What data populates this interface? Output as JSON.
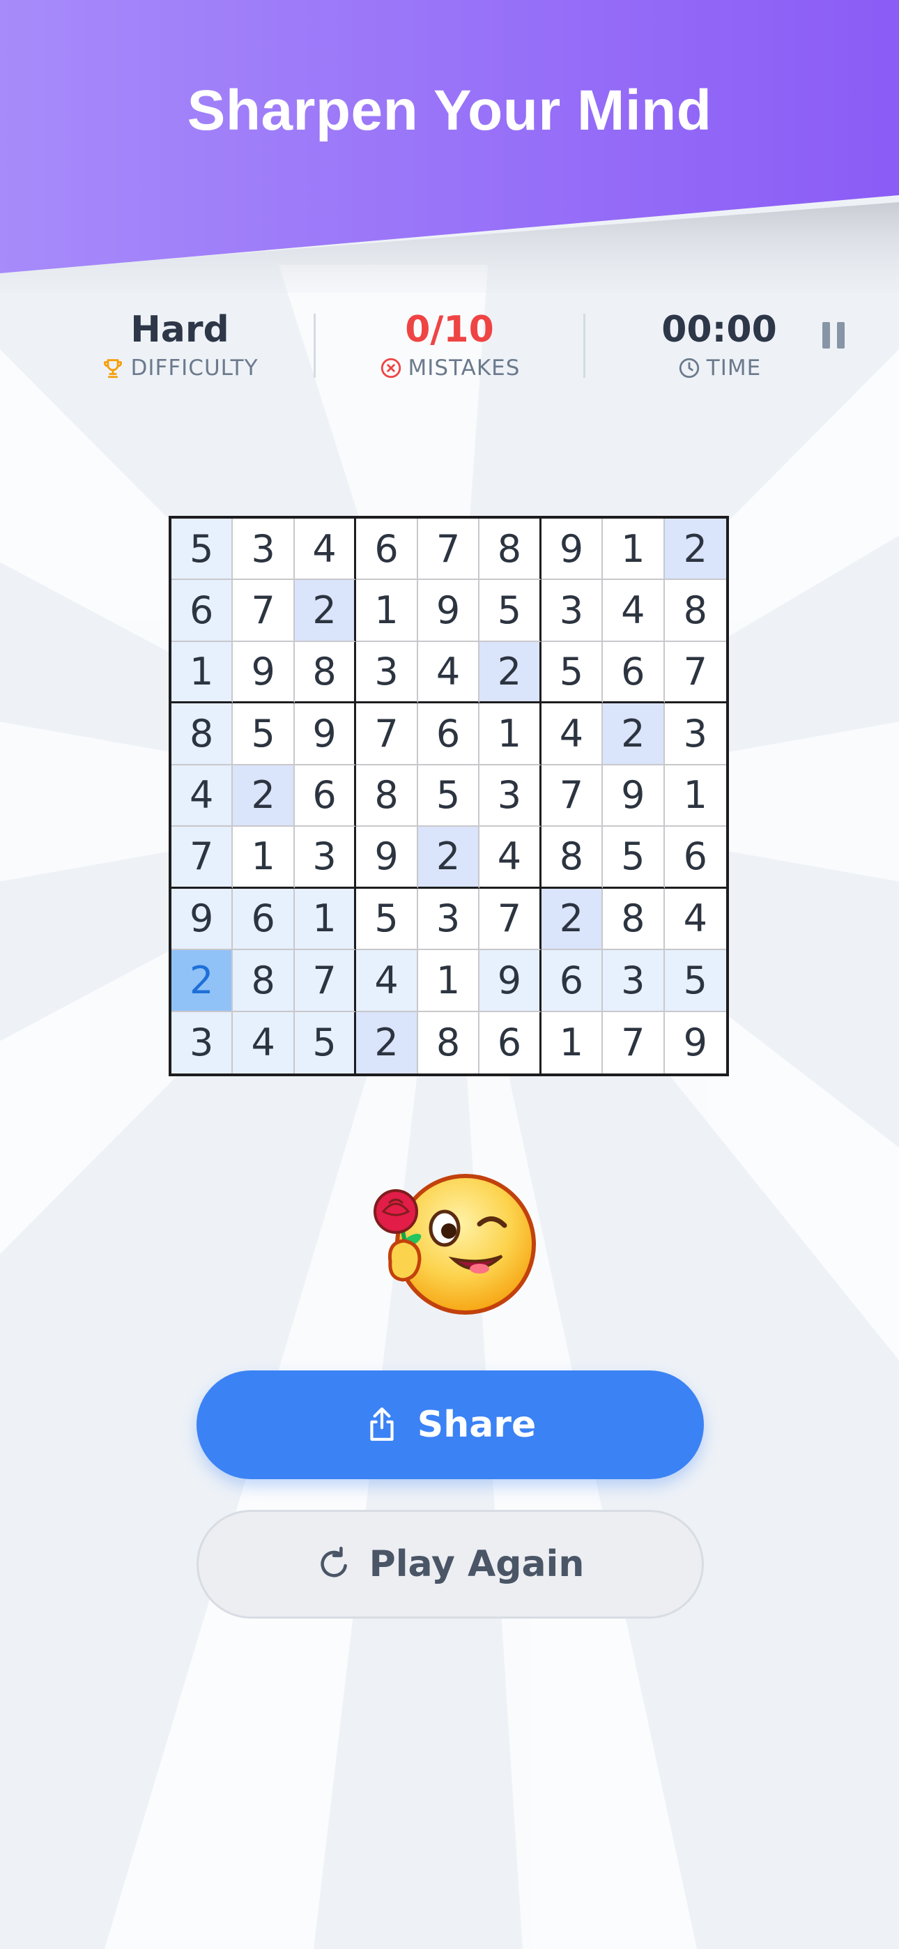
{
  "header": {
    "title": "Sharpen Your Mind",
    "gradient_start": "#a78bfa",
    "gradient_end": "#8b5cf6"
  },
  "stats": {
    "difficulty": {
      "value": "Hard",
      "label": "DIFFICULTY",
      "icon": "trophy-icon"
    },
    "mistakes": {
      "value": "0/10",
      "label": "MISTAKES",
      "icon": "x-circle-icon",
      "color": "#ef4444"
    },
    "time": {
      "value": "00:00",
      "label": "TIME",
      "icon": "clock-icon"
    }
  },
  "board": {
    "rows": [
      [
        5,
        3,
        4,
        6,
        7,
        8,
        9,
        1,
        2
      ],
      [
        6,
        7,
        2,
        1,
        9,
        5,
        3,
        4,
        8
      ],
      [
        1,
        9,
        8,
        3,
        4,
        2,
        5,
        6,
        7
      ],
      [
        8,
        5,
        9,
        7,
        6,
        1,
        4,
        2,
        3
      ],
      [
        4,
        2,
        6,
        8,
        5,
        3,
        7,
        9,
        1
      ],
      [
        7,
        1,
        3,
        9,
        2,
        4,
        8,
        5,
        6
      ],
      [
        9,
        6,
        1,
        5,
        3,
        7,
        2,
        8,
        4
      ],
      [
        2,
        8,
        7,
        4,
        1,
        9,
        6,
        3,
        5
      ],
      [
        3,
        4,
        5,
        2,
        8,
        6,
        1,
        7,
        9
      ]
    ],
    "selected_cell": {
      "row": 8,
      "col": 1,
      "value": 2
    }
  },
  "buttons": {
    "share": {
      "label": "Share",
      "icon": "share-icon"
    },
    "play_again": {
      "label": "Play Again",
      "icon": "refresh-icon"
    }
  },
  "emoji": {
    "icon": "winking-face-with-rose-icon"
  }
}
